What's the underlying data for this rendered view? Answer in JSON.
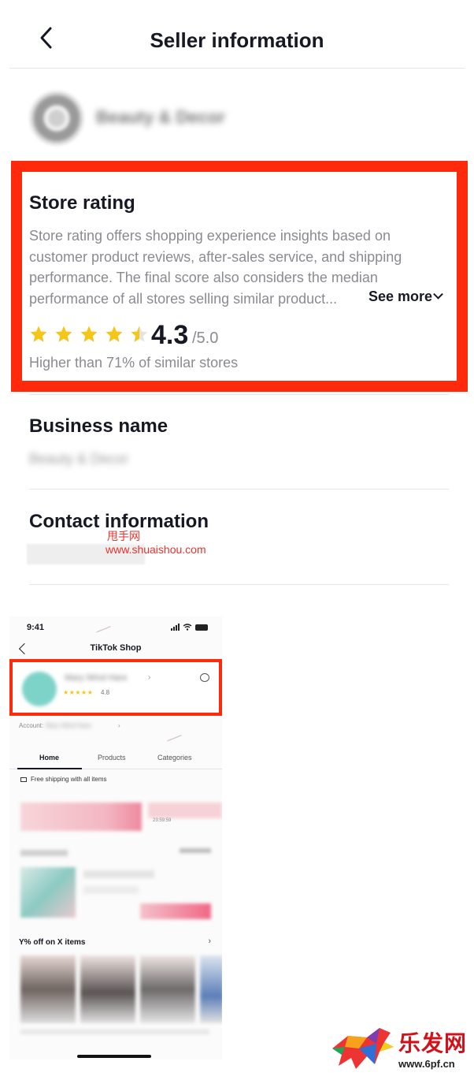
{
  "header": {
    "title": "Seller information",
    "back_icon": "chevron-left-icon"
  },
  "seller": {
    "name_blurred": "Beauty & Decor"
  },
  "store_rating": {
    "title": "Store rating",
    "description": "Store rating offers shopping experience insights based on customer product reviews, after-sales service, and shipping performance. The final score also considers the median performance of all stores selling similar product...",
    "see_more": "See more",
    "score": "4.3",
    "score_max": "/5.0",
    "stars_filled": 4.3,
    "star_color": "#f5c518",
    "comparison": "Higher than 71% of similar stores"
  },
  "business": {
    "title": "Business name",
    "value_blurred": "Beauty & Decor"
  },
  "contact": {
    "title": "Contact information"
  },
  "watermark": {
    "cn": "甩手网",
    "url": "www.shuaishou.com"
  },
  "highlight_color": "#ff2a0b",
  "phone_screenshot": {
    "time": "9:41",
    "title": "TikTok Shop",
    "shop_name_blurred": "Mary Wind Hare",
    "arrow": "›",
    "stars": "★★★★★",
    "rating": "4.8",
    "account_label": "Account:",
    "account_value_blurred": "Mary Wind Hare",
    "tabs": [
      "Home",
      "Products",
      "Categories"
    ],
    "shipping": "Free shipping with all items",
    "timer": "23:59:59",
    "offer": "Y% off on X items",
    "offer_arrow": "›"
  },
  "logo": {
    "cn": "乐发网",
    "url": "www.6pf.cn"
  }
}
